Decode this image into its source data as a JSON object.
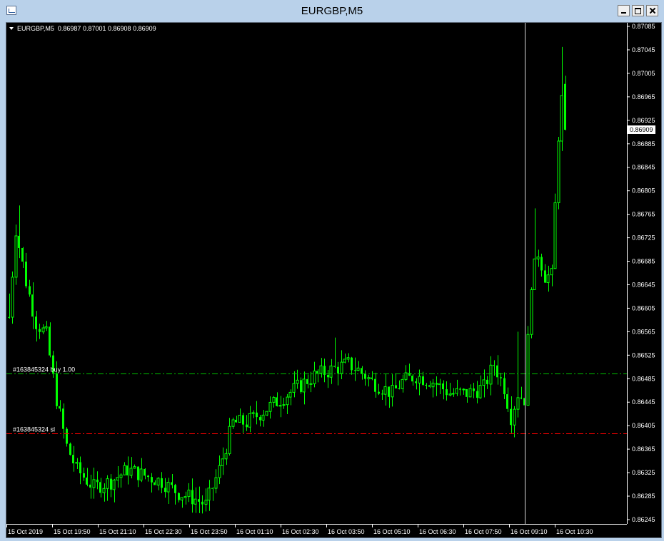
{
  "window": {
    "title": "EURGBP,M5"
  },
  "chart_info": {
    "symbol": "EURGBP,M5",
    "open": "0.86987",
    "high": "0.87001",
    "low": "0.86908",
    "close": "0.86909"
  },
  "colors": {
    "background": "#000000",
    "candle": "#00ff00",
    "grid_fg": "#ffffff",
    "buy_line": "#00c000",
    "sl_line": "#ff0000",
    "crosshair": "#ffffffb0"
  },
  "price_axis": {
    "ticks": [
      "0.87085",
      "0.87045",
      "0.87005",
      "0.86965",
      "0.86925",
      "0.86885",
      "0.86845",
      "0.86805",
      "0.86765",
      "0.86725",
      "0.86685",
      "0.86645",
      "0.86605",
      "0.86565",
      "0.86525",
      "0.86485",
      "0.86445",
      "0.86405",
      "0.86365",
      "0.86325",
      "0.86285",
      "0.86245"
    ],
    "current_price": "0.86909"
  },
  "time_axis": {
    "ticks": [
      "15 Oct 2019",
      "15 Oct 19:50",
      "15 Oct 21:10",
      "15 Oct 22:30",
      "15 Oct 23:50",
      "16 Oct 01:10",
      "16 Oct 02:30",
      "16 Oct 03:50",
      "16 Oct 05:10",
      "16 Oct 06:30",
      "16 Oct 07:50",
      "16 Oct 09:10",
      "16 Oct 10:30"
    ]
  },
  "orders": [
    {
      "label": "#163845324 buy 1.00",
      "price": 0.86494,
      "type": "buy"
    },
    {
      "label": "#163845324 sl",
      "price": 0.86392,
      "type": "sl"
    }
  ],
  "chart_data": {
    "type": "candlestick",
    "symbol": "EURGBP",
    "timeframe": "M5",
    "ylim": [
      0.86245,
      0.87085
    ],
    "close_path": [
      [
        0,
        0.8659
      ],
      [
        2,
        0.8674
      ],
      [
        5,
        0.8665
      ],
      [
        8,
        0.8658
      ],
      [
        11,
        0.8656
      ],
      [
        14,
        0.8645
      ],
      [
        17,
        0.8637
      ],
      [
        20,
        0.8633
      ],
      [
        25,
        0.863
      ],
      [
        30,
        0.8631
      ],
      [
        35,
        0.8633
      ],
      [
        40,
        0.8632
      ],
      [
        45,
        0.8631
      ],
      [
        50,
        0.8629
      ],
      [
        55,
        0.8628
      ],
      [
        58,
        0.8627
      ],
      [
        62,
        0.8633
      ],
      [
        66,
        0.8641
      ],
      [
        70,
        0.8641
      ],
      [
        75,
        0.8643
      ],
      [
        80,
        0.8645
      ],
      [
        85,
        0.8647
      ],
      [
        90,
        0.8649
      ],
      [
        95,
        0.865
      ],
      [
        100,
        0.8651
      ],
      [
        103,
        0.865
      ],
      [
        107,
        0.8648
      ],
      [
        110,
        0.8647
      ],
      [
        113,
        0.8646
      ],
      [
        116,
        0.8648
      ],
      [
        120,
        0.8649
      ],
      [
        125,
        0.8648
      ],
      [
        130,
        0.8646
      ],
      [
        135,
        0.8646
      ],
      [
        140,
        0.8647
      ],
      [
        143,
        0.8651
      ],
      [
        146,
        0.8647
      ],
      [
        148,
        0.8642
      ],
      [
        150,
        0.8646
      ],
      [
        152,
        0.8645
      ],
      [
        154,
        0.8665
      ],
      [
        156,
        0.867
      ],
      [
        158,
        0.8666
      ],
      [
        160,
        0.8666
      ],
      [
        162,
        0.869
      ],
      [
        163,
        0.8696
      ],
      [
        164,
        0.86909
      ]
    ],
    "total_bars": 165,
    "time_ticks": [
      "15 Oct 2019",
      "15 Oct 19:50",
      "15 Oct 21:10",
      "15 Oct 22:30",
      "15 Oct 23:50",
      "16 Oct 01:10",
      "16 Oct 02:30",
      "16 Oct 03:50",
      "16 Oct 05:10",
      "16 Oct 06:30",
      "16 Oct 07:50",
      "16 Oct 09:10",
      "16 Oct 10:30"
    ],
    "last": {
      "open": 0.86987,
      "high": 0.87001,
      "low": 0.86908,
      "close": 0.86909
    },
    "grid": false
  }
}
